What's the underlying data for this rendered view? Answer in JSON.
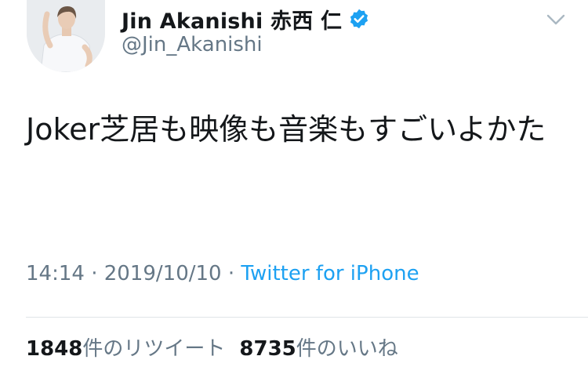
{
  "user": {
    "display_name": "Jin Akanishi  赤西 仁",
    "handle": "@Jin_Akanishi",
    "verified_icon": "verified-badge-icon",
    "avatar": "profile-photo"
  },
  "tweet": {
    "text": "Joker芝居も映像も音楽もすごいよかた",
    "time": "14:14",
    "separator": " · ",
    "date": "2019/10/10",
    "source": "Twitter for iPhone"
  },
  "stats": {
    "retweets_count": "1848",
    "retweets_label": "件のリツイート",
    "likes_count": "8735",
    "likes_label": "件のいいね"
  },
  "colors": {
    "accent": "#1da1f2",
    "text": "#14171a",
    "muted": "#657786"
  }
}
